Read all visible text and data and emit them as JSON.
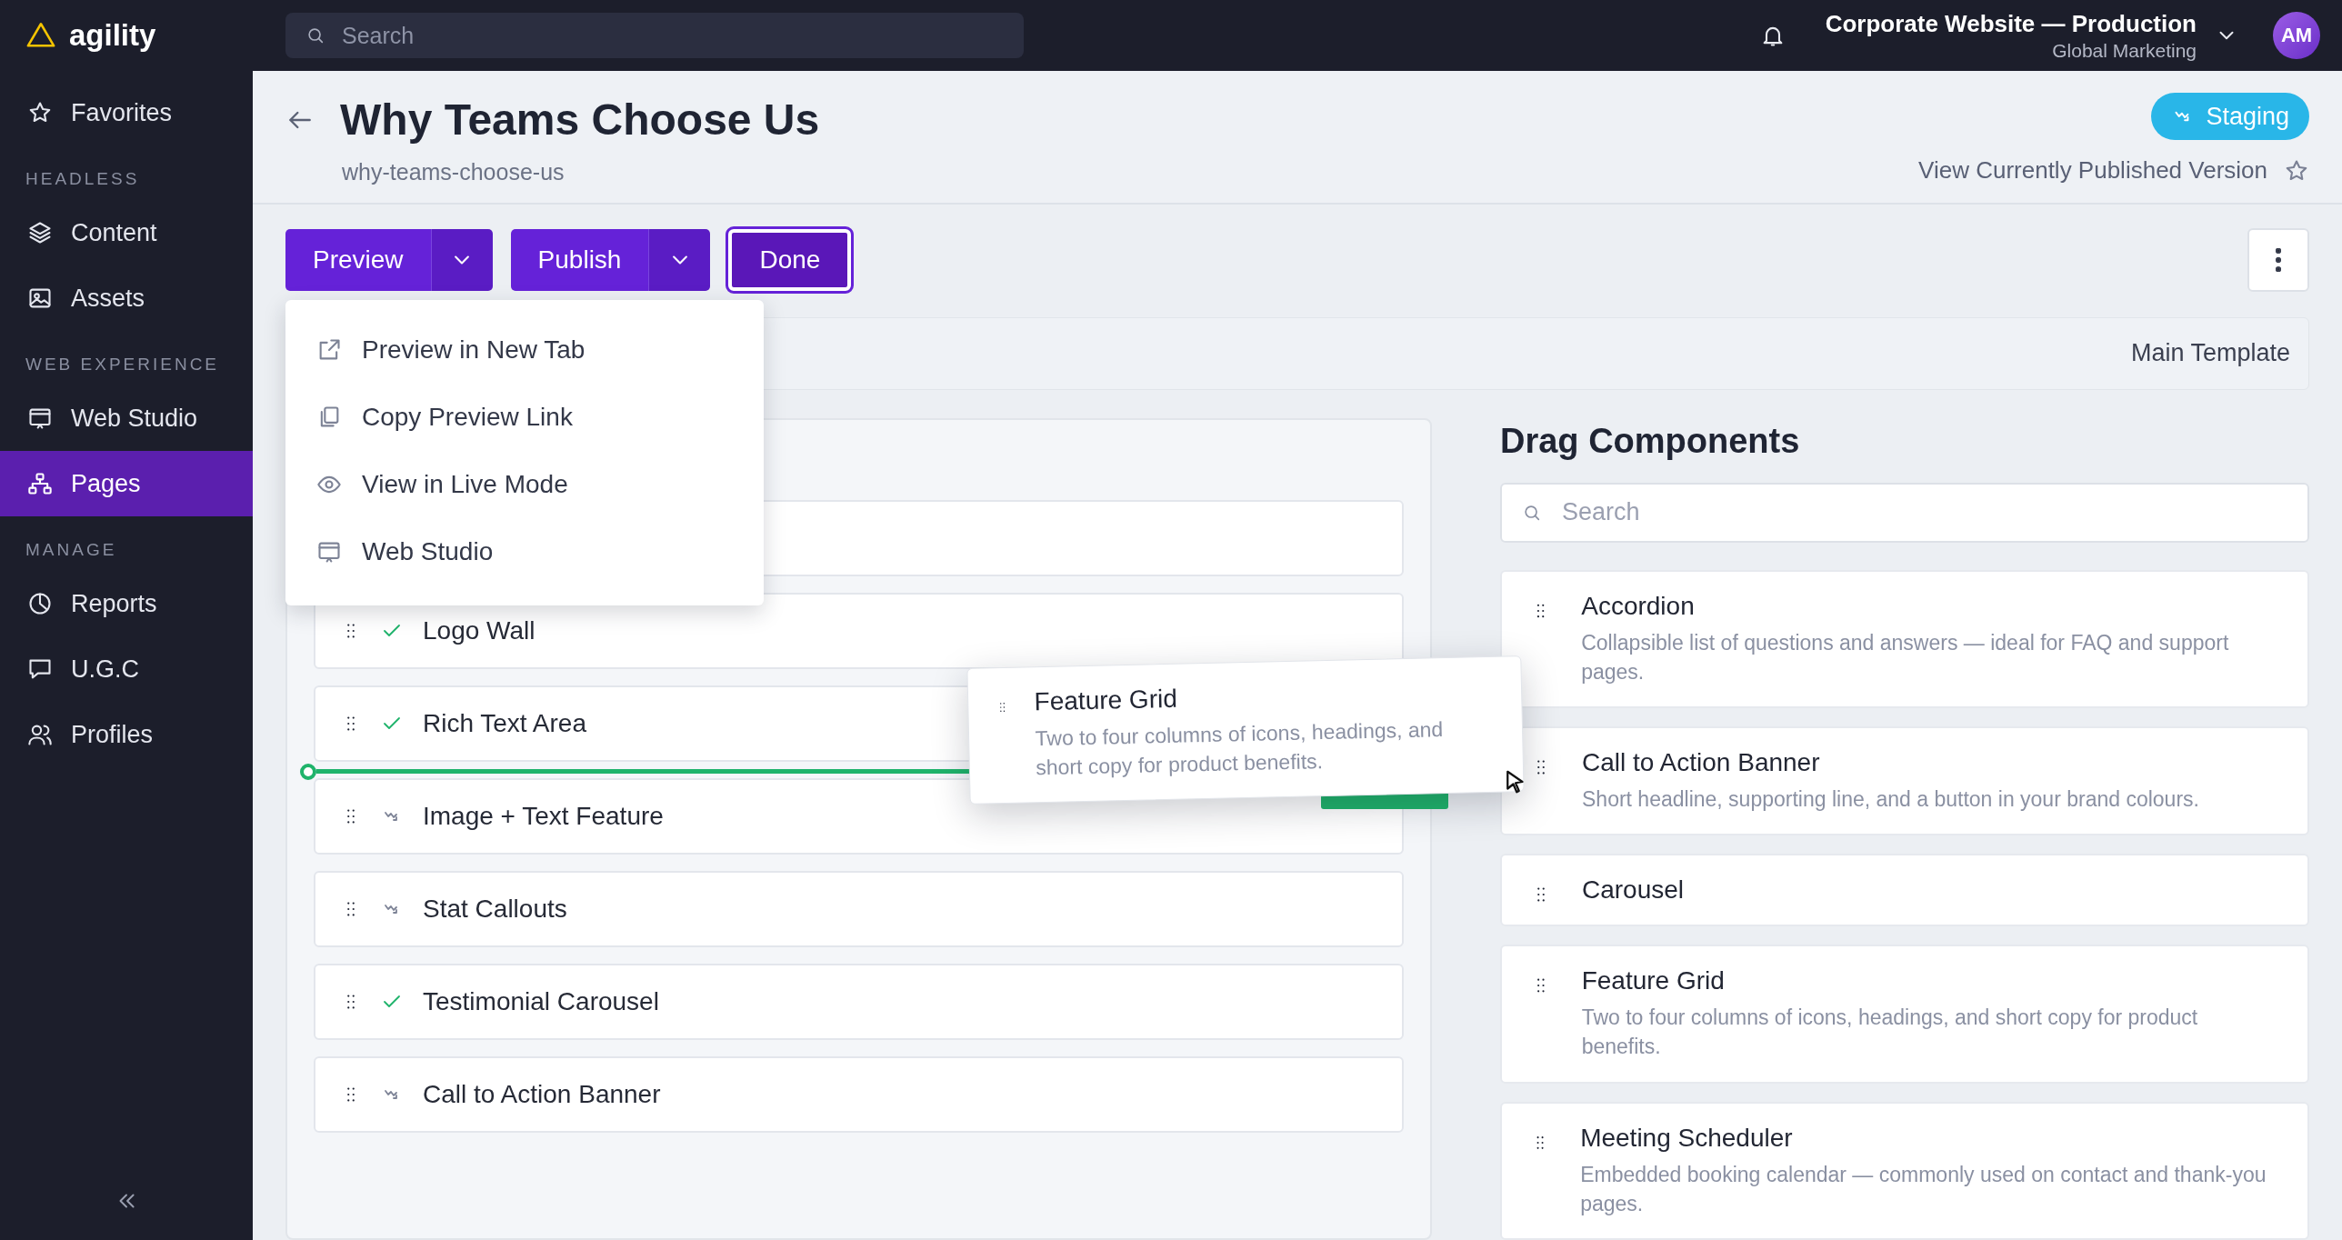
{
  "topbar": {
    "logo": "agility",
    "search": {
      "placeholder": "Search"
    },
    "site": {
      "title": "Corporate Website — Production",
      "subtitle": "Global Marketing"
    },
    "avatar": "AM"
  },
  "sidebar": {
    "sections": [
      {
        "items": [
          {
            "label": "Favorites",
            "selected": false
          }
        ]
      },
      {
        "label": "HEADLESS",
        "items": [
          {
            "label": "Content",
            "selected": false
          },
          {
            "label": "Assets",
            "selected": false
          }
        ]
      },
      {
        "label": "WEB EXPERIENCE",
        "items": [
          {
            "label": "Web Studio",
            "selected": false
          },
          {
            "label": "Pages",
            "selected": true
          }
        ]
      },
      {
        "label": "MANAGE",
        "items": [
          {
            "label": "Reports",
            "selected": false
          },
          {
            "label": "U.G.C",
            "selected": false
          },
          {
            "label": "Profiles",
            "selected": false
          }
        ]
      }
    ]
  },
  "page": {
    "title": "Why Teams Choose Us",
    "slug": "why-teams-choose-us",
    "status_badge": "Staging",
    "published_link": "View Currently Published Version"
  },
  "toolbar": {
    "buttons": [
      {
        "label": "Preview",
        "kind": "split"
      },
      {
        "label": "Publish",
        "kind": "split"
      },
      {
        "label": "Done",
        "kind": "outlined"
      }
    ]
  },
  "preview_menu": {
    "items": [
      {
        "label": "Preview in New Tab"
      },
      {
        "label": "Copy Preview Link"
      },
      {
        "label": "View in Live Mode"
      },
      {
        "label": "Web Studio"
      }
    ]
  },
  "template": {
    "name": "Main Template"
  },
  "page_components": {
    "rows": [
      {
        "name": "Logo Wall",
        "published": true
      },
      {
        "name": "Rich Text Area",
        "published": true
      },
      {
        "name": "Image + Text Feature",
        "published": false
      },
      {
        "name": "Stat Callouts",
        "published": false
      },
      {
        "name": "Testimonial Carousel",
        "published": true
      },
      {
        "name": "Call to Action Banner",
        "published": false
      }
    ]
  },
  "drag_preview": {
    "title": "Feature Grid",
    "description": "Two to four columns of icons, headings, and short copy for product benefits."
  },
  "components_panel": {
    "title": "Drag Components",
    "search": {
      "placeholder": "Search"
    },
    "items": [
      {
        "name": "Accordion",
        "description": "Collapsible list of questions and answers — ideal for FAQ and support pages."
      },
      {
        "name": "Call to Action Banner",
        "description": "Short headline, supporting line, and a button in your brand colours."
      },
      {
        "name": "Carousel"
      },
      {
        "name": "Feature Grid",
        "description": "Two to four columns of icons, headings, and short copy for product benefits."
      },
      {
        "name": "Meeting Scheduler",
        "description": "Embedded booking calendar — commonly used on contact and thank-you pages."
      }
    ]
  }
}
